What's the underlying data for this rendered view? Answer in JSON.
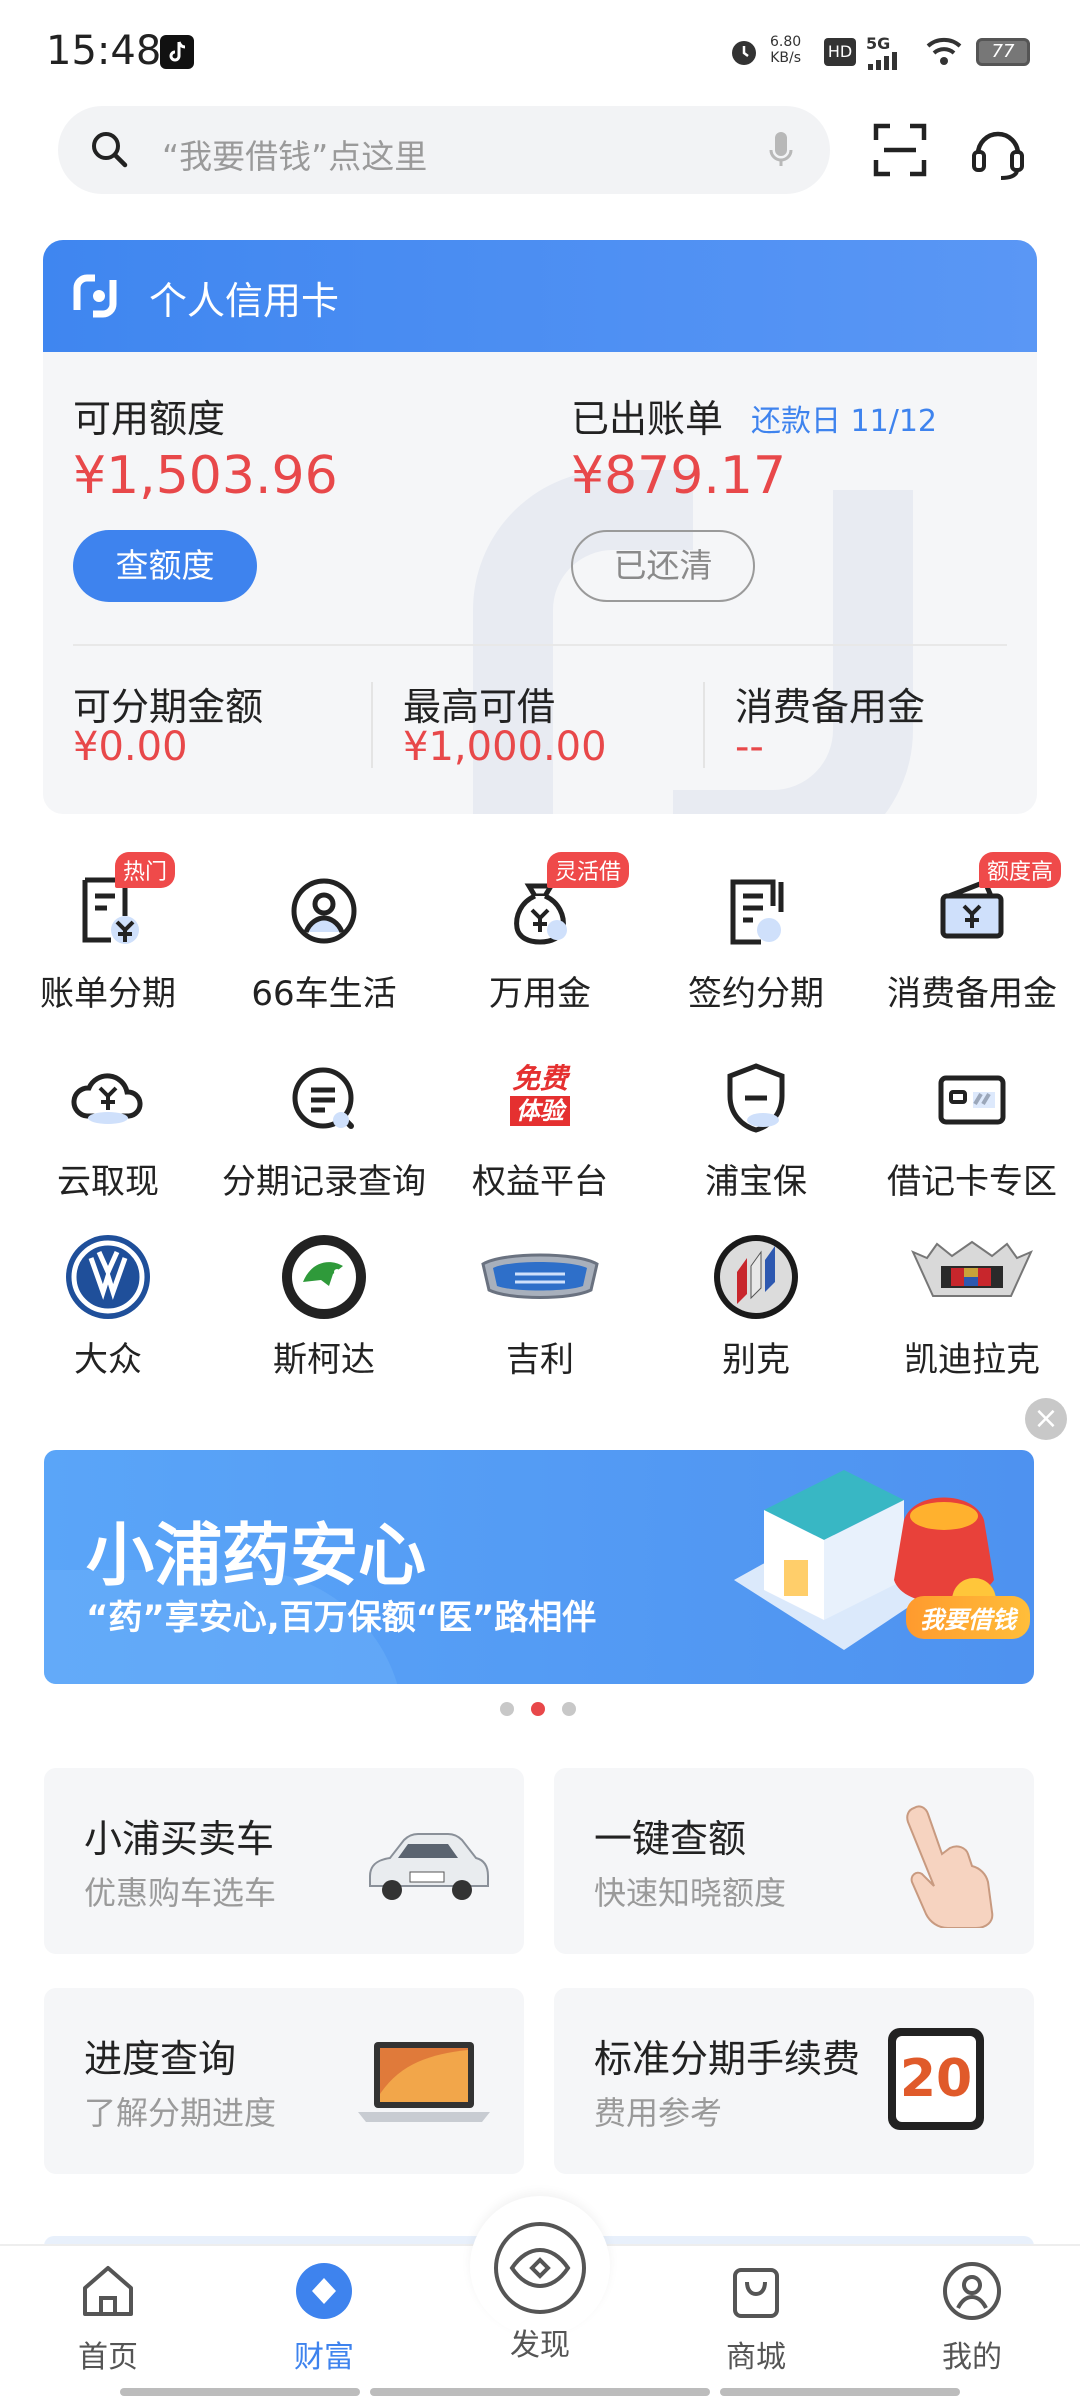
{
  "status_bar": {
    "time": "15:48",
    "net_speed": "6.80",
    "net_unit": "KB/s",
    "hd": "HD",
    "signal": "5G",
    "battery": "77"
  },
  "search": {
    "placeholder": "“我要借钱”点这里"
  },
  "card": {
    "title": "个人信用card",
    "available_label": "可用额度",
    "available_amount": "¥1,503.96",
    "check_button": "查额度",
    "bill_label": "已出账单",
    "due_label": "还款日 11/12",
    "bill_amount": "¥879.17",
    "paid_button": "已还清",
    "installment_label": "可分期金额",
    "installment_amount": "¥0.00",
    "max_borrow_label": "最高可借",
    "max_borrow_amount": "¥1,000.00",
    "reserve_label": "消费备用金",
    "reserve_amount": "--"
  },
  "grid_row1": [
    {
      "label": "账单分期",
      "tag": "热门",
      "icon": "bill-installment-icon"
    },
    {
      "label": "66车生活",
      "tag": "",
      "icon": "car-life-icon"
    },
    {
      "label": "万用金",
      "tag": "灵活借",
      "icon": "money-bag-icon"
    },
    {
      "label": "签约分期",
      "tag": "",
      "icon": "contract-icon"
    },
    {
      "label": "消费备用金",
      "tag": "额度高",
      "icon": "wallet-icon"
    }
  ],
  "grid_row2": [
    {
      "label": "云取现",
      "icon": "cloud-cash-icon"
    },
    {
      "label": "分期记录查询",
      "icon": "record-search-icon"
    },
    {
      "label": "权益平台",
      "icon": "free-trial-icon",
      "badge_top": "免费",
      "badge_bottom": "体验"
    },
    {
      "label": "浦宝保",
      "icon": "shield-icon"
    },
    {
      "label": "借记卡专区",
      "icon": "debit-card-icon"
    }
  ],
  "grid_row3": [
    {
      "label": "大众",
      "icon": "volkswagen-logo-icon"
    },
    {
      "label": "斯柯达",
      "icon": "skoda-logo-icon"
    },
    {
      "label": "吉利",
      "icon": "geely-logo-icon"
    },
    {
      "label": "别克",
      "icon": "buick-logo-icon"
    },
    {
      "label": "凯迪拉克",
      "icon": "cadillac-logo-icon"
    }
  ],
  "banner": {
    "title": "小浦药安心",
    "subtitle": "“药”享安心,百万保额“医”路相伴",
    "cta": "我要借钱",
    "active_dot": 1,
    "dot_count": 3
  },
  "tiles": [
    {
      "title": "小浦买卖车",
      "subtitle": "优惠购车选车",
      "icon": "car-image-icon"
    },
    {
      "title": "一键查额",
      "subtitle": "快速知晓额度",
      "icon": "hand-tap-icon"
    },
    {
      "title": "进度查询",
      "subtitle": "了解分期进度",
      "icon": "laptop-icon"
    },
    {
      "title": "标准分期手续费",
      "subtitle": "费用参考",
      "icon": "calendar-icon",
      "calendar_number": "20"
    }
  ],
  "nav": [
    {
      "label": "首页",
      "icon": "home-icon",
      "active": false
    },
    {
      "label": "财富",
      "icon": "wealth-icon",
      "active": true
    },
    {
      "label": "发现",
      "icon": "eye-icon",
      "active": false
    },
    {
      "label": "商城",
      "icon": "shopping-bag-icon",
      "active": false
    },
    {
      "label": "我的",
      "icon": "profile-icon",
      "active": false
    }
  ],
  "colors": {
    "accent": "#3e83ee",
    "amount_red": "#e8484a",
    "tag_red": "#ef4a4a"
  }
}
